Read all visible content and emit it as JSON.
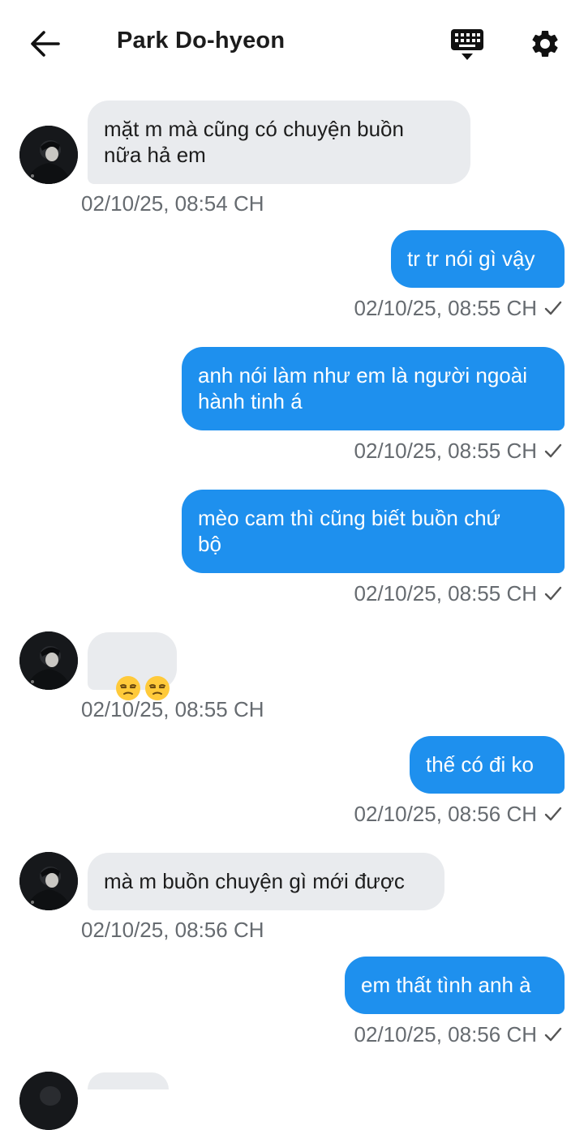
{
  "header": {
    "title": "Park Do-hyeon"
  },
  "messages": [
    {
      "direction": "in",
      "text": "mặt m mà cũng có chuyện buồn\nnữa hả em",
      "time": "02/10/25, 08:54 CH"
    },
    {
      "direction": "out",
      "text": "tr tr nói gì vậy",
      "time": "02/10/25, 08:55 CH"
    },
    {
      "direction": "out",
      "text": "anh nói làm như em là người ngoài\nhành tinh á",
      "time": "02/10/25, 08:55 CH"
    },
    {
      "direction": "out",
      "text": "mèo cam thì cũng biết buồn chứ\nbộ",
      "time": "02/10/25, 08:55 CH"
    },
    {
      "direction": "in",
      "text": "",
      "emoji": [
        "unamused-face",
        "unamused-face"
      ],
      "time": "02/10/25, 08:55 CH"
    },
    {
      "direction": "out",
      "text": "thế có đi ko",
      "time": "02/10/25, 08:56 CH"
    },
    {
      "direction": "in",
      "text": "mà m buồn chuyện gì mới được",
      "time": "02/10/25, 08:56 CH"
    },
    {
      "direction": "out",
      "text": "em thất tình anh à",
      "time": "02/10/25, 08:56 CH"
    }
  ],
  "icons": {
    "back": "arrow-left-icon",
    "keyboard": "keyboard-icon",
    "settings": "gear-icon",
    "sent_status": "checkmark-icon"
  },
  "colors": {
    "outgoing_bubble": "#1e90ee",
    "incoming_bubble": "#e9ebee",
    "timestamp": "#666b70"
  }
}
